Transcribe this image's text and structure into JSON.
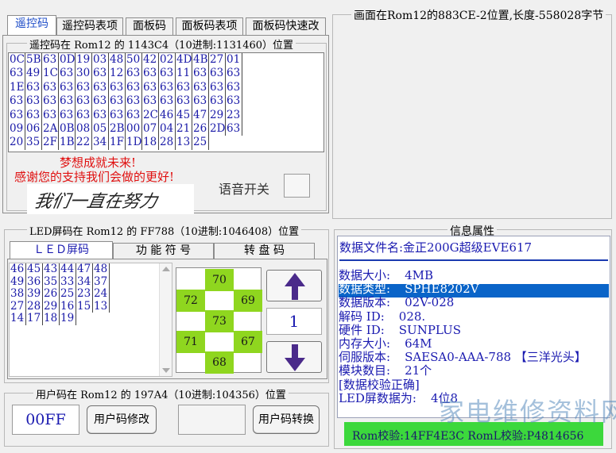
{
  "tabs": [
    "遥控码",
    "遥控码表项",
    "面板码",
    "面板码表项",
    "面板码快速改"
  ],
  "image_title": "画面在Rom12的883CE-2位置,长度-558028字节",
  "remote": {
    "legend": "遥控码在 Rom12 的 1143C4（10进制:1131460）位置",
    "hex_rows": [
      [
        "0C",
        "5B",
        "63",
        "0D",
        "19",
        "03",
        "48",
        "50",
        "42",
        "02",
        "4D",
        "4B",
        "27",
        "01"
      ],
      [
        "63",
        "49",
        "1C",
        "63",
        "30",
        "63",
        "12",
        "63",
        "63",
        "63",
        "11",
        "63",
        "63",
        "63"
      ],
      [
        "1E",
        "63",
        "63",
        "63",
        "63",
        "63",
        "63",
        "63",
        "63",
        "63",
        "63",
        "63",
        "63",
        "63"
      ],
      [
        "63",
        "63",
        "63",
        "63",
        "63",
        "63",
        "63",
        "63",
        "63",
        "63",
        "63",
        "63",
        "63",
        "63"
      ],
      [
        "63",
        "63",
        "63",
        "63",
        "63",
        "63",
        "63",
        "63",
        "2C",
        "46",
        "45",
        "47",
        "29",
        "23"
      ],
      [
        "09",
        "06",
        "2A",
        "0B",
        "08",
        "05",
        "2B",
        "00",
        "07",
        "04",
        "21",
        "26",
        "2D",
        "63"
      ],
      [
        "20",
        "35",
        "2F",
        "1B",
        "22",
        "34",
        "1F",
        "1D",
        "18",
        "28",
        "13",
        "25",
        "",
        ""
      ]
    ],
    "slogan1": "梦想成就未来!",
    "slogan2": "感谢您的支持我们会做的更好!",
    "signature": "我们一直在努力",
    "voice_label": "语音开关"
  },
  "led": {
    "legend": "LED屏码在 Rom12 的 FF788（10进制:1046408）位置",
    "subtabs": [
      "ＬＥＤ屏码",
      "功 能 符 号",
      "转 盘 码"
    ],
    "list_rows": [
      [
        "46",
        "45",
        "43",
        "44",
        "47",
        "48"
      ],
      [
        "49",
        "36",
        "35",
        "33",
        "34",
        "37"
      ],
      [
        "38",
        "39",
        "26",
        "25",
        "23",
        "24"
      ],
      [
        "27",
        "28",
        "29",
        "16",
        "15",
        "13"
      ],
      [
        "14",
        "17",
        "18",
        "19",
        "",
        ""
      ]
    ],
    "keypad": {
      "top": "70",
      "left": "72",
      "right": "69",
      "center": "73",
      "bottomleft": "71",
      "bottomright": "67",
      "bottom": "68"
    },
    "counter": "1"
  },
  "user": {
    "legend": "用户码在 Rom12 的 197A4（10进制:104356）位置",
    "code": "00FF",
    "modify_button": "用户码修改",
    "input_value": "",
    "convert_button": "用户码转换"
  },
  "info": {
    "title": "信息属性",
    "file_name": "数据文件名:金正200G超级EVE617",
    "lines": [
      {
        "label": "数据大小:",
        "value": "4MB"
      },
      {
        "label": "数据类型:",
        "value": "SPHE8202V"
      },
      {
        "label": "数据版本:",
        "value": "02V-028"
      },
      {
        "label": "解码  ID:",
        "value": "028."
      },
      {
        "label": "硬件  ID:",
        "value": "SUNPLUS"
      },
      {
        "label": "内存大小:",
        "value": "64M"
      },
      {
        "label": "伺服版本:",
        "value": "SAESA0-AAA-788 【三洋光头】"
      },
      {
        "label": "模块数目:",
        "value": "21个"
      },
      {
        "label": "[数据校验正确]",
        "value": ""
      },
      {
        "label": "LED屏数据为:",
        "value": "4位8"
      }
    ],
    "checksum": "Rom校验:14FF4E3C  RomL校验:P4814656"
  },
  "watermark": "家电维修资料网",
  "colors": {
    "accent_blue": "#1a1ab0",
    "green": "#8fd61f",
    "highlight": "#0a64c8",
    "red": "#e01010"
  }
}
